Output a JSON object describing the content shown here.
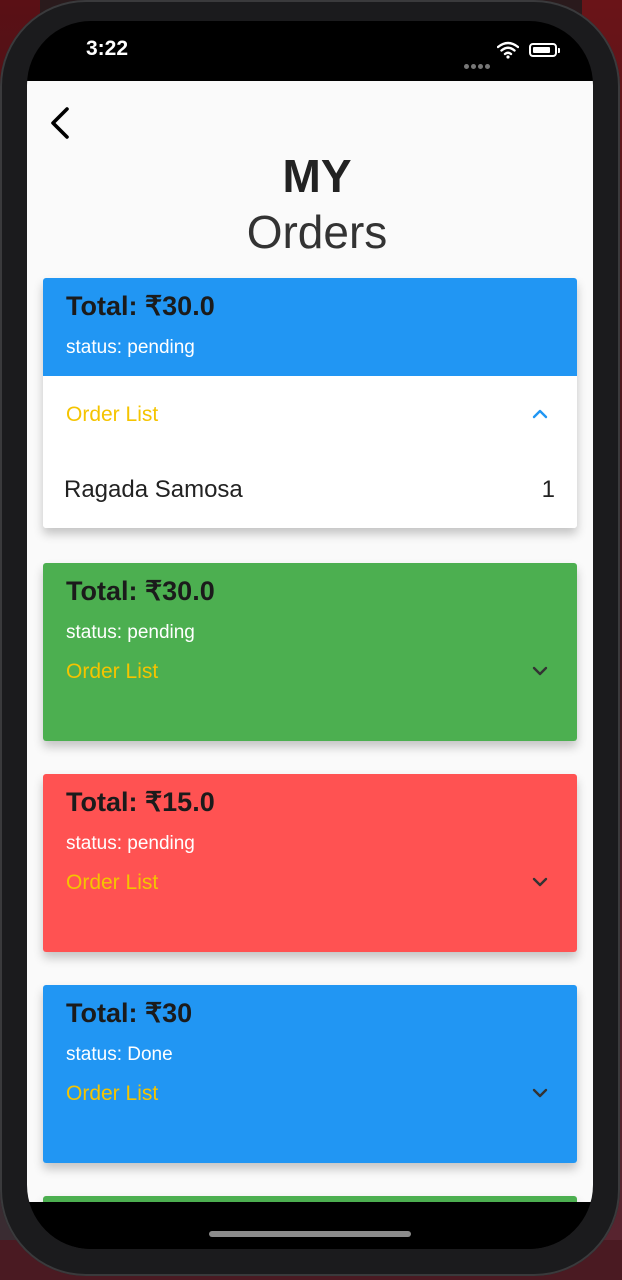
{
  "status_bar": {
    "time": "3:22"
  },
  "header": {
    "title_bold": "MY",
    "title_regular": "Orders"
  },
  "orders": [
    {
      "total": "Total: ₹30.0",
      "status": "status: pending",
      "color": "#2196f3",
      "expanded": true,
      "list_label": "Order List",
      "items": [
        {
          "name": "Ragada Samosa",
          "qty": "1"
        }
      ]
    },
    {
      "total": "Total: ₹30.0",
      "status": "status: pending",
      "color": "#4caf50",
      "expanded": false,
      "list_label": "Order List",
      "items": []
    },
    {
      "total": "Total: ₹15.0",
      "status": "status: pending",
      "color": "#ff5252",
      "expanded": false,
      "list_label": "Order List",
      "items": []
    },
    {
      "total": "Total: ₹30",
      "status": "status: Done",
      "color": "#2196f3",
      "expanded": false,
      "list_label": "Order List",
      "items": []
    }
  ],
  "partial_card_color": "#4caf50",
  "accent": {
    "order_list_text": "#f5c400",
    "expanded_chevron": "#2196f3"
  },
  "icons": {
    "back": "back-arrow-icon",
    "expand": "chevron-up-icon",
    "collapse": "chevron-down-icon"
  }
}
